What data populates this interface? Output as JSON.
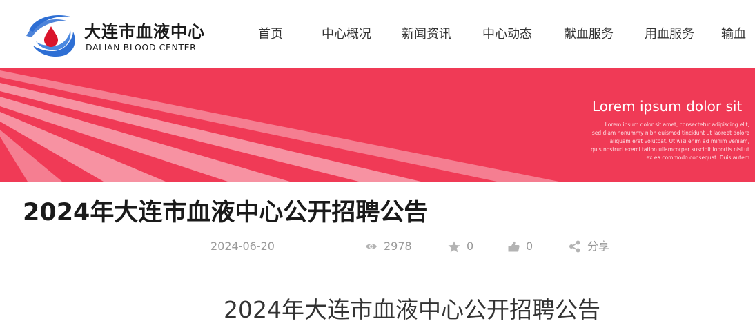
{
  "header": {
    "logo": {
      "name_cn": "大连市血液中心",
      "name_en": "DALIAN BLOOD CENTER",
      "colors": {
        "blue": "#2e6fd4",
        "red": "#d9142b"
      }
    },
    "nav": [
      "首页",
      "中心概况",
      "新闻资讯",
      "中心动态",
      "献血服务",
      "用血服务",
      "输血"
    ]
  },
  "banner": {
    "background": "#f03a56",
    "headline": "Lorem ipsum dolor sit",
    "sub_lines": [
      "Lorem ipsum dolor sit amet, consectetur adipiscing elit,",
      "sed diam nonummy nibh euismod tincidunt ut laoreet dolore",
      "aliquam erat volutpat. Ut wisi enim ad minim veniam,",
      "quis nostrud exerci tation ullamcorper suscipit lobortis nisl ut",
      "ex ea commodo consequat. Duis autem"
    ]
  },
  "article": {
    "title": "2024年大连市血液中心公开招聘公告",
    "meta": {
      "date": "2024-06-20",
      "views": "2978",
      "favorites": "0",
      "likes": "0",
      "share_label": "分享"
    },
    "content_heading": "2024年大连市血液中心公开招聘公告"
  }
}
